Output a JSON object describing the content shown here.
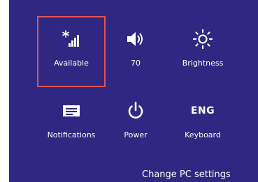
{
  "quick_settings": {
    "network": {
      "label": "Available",
      "icon": "network-available-icon"
    },
    "volume": {
      "label": "70",
      "icon": "speaker-icon"
    },
    "brightness": {
      "label": "Brightness",
      "icon": "brightness-sun-icon"
    },
    "notifications": {
      "label": "Notifications",
      "icon": "notifications-icon"
    },
    "power": {
      "label": "Power",
      "icon": "power-icon"
    },
    "keyboard": {
      "label": "Keyboard",
      "icon_text": "ENG"
    }
  },
  "footer": {
    "change_pc_settings": "Change PC settings"
  },
  "colors": {
    "background": "#2f2781",
    "selection": "#e05555",
    "text": "#ffffff"
  }
}
